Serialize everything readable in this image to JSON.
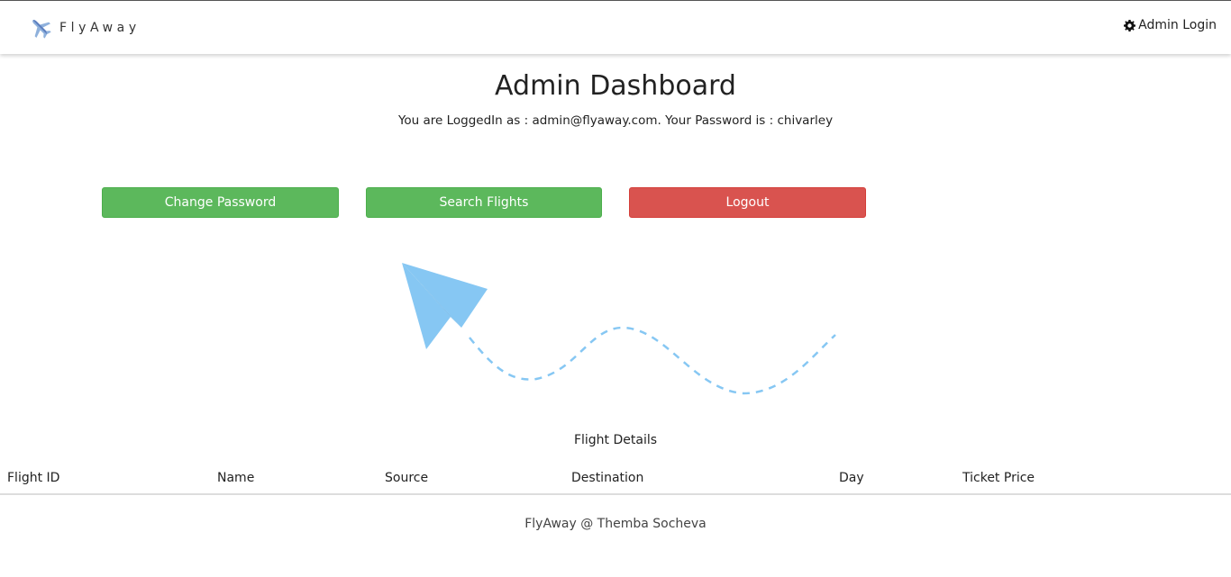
{
  "navbar": {
    "brand_name": "FlyAway",
    "brand_icon": "airplane-icon",
    "admin_login_label": "Admin Login",
    "admin_login_icon": "gear-icon"
  },
  "main": {
    "title": "Admin Dashboard",
    "logged_in_text": "You are LoggedIn as : admin@flyaway.com. Your Password is : chivarley"
  },
  "actions": {
    "change_password_label": "Change Password",
    "search_flights_label": "Search Flights",
    "logout_label": "Logout"
  },
  "illustration": {
    "icon": "paper-plane-icon"
  },
  "flight_table": {
    "caption": "Flight Details",
    "columns": [
      "Flight ID",
      "Name",
      "Source",
      "Destination",
      "Day",
      "Ticket Price"
    ],
    "rows": []
  },
  "footer": {
    "text": "FlyAway @ Themba Socheva"
  },
  "colors": {
    "success": "#5cb85c",
    "danger": "#d9534f",
    "plane": "#86c7f3",
    "trail": "#86c7f3"
  }
}
